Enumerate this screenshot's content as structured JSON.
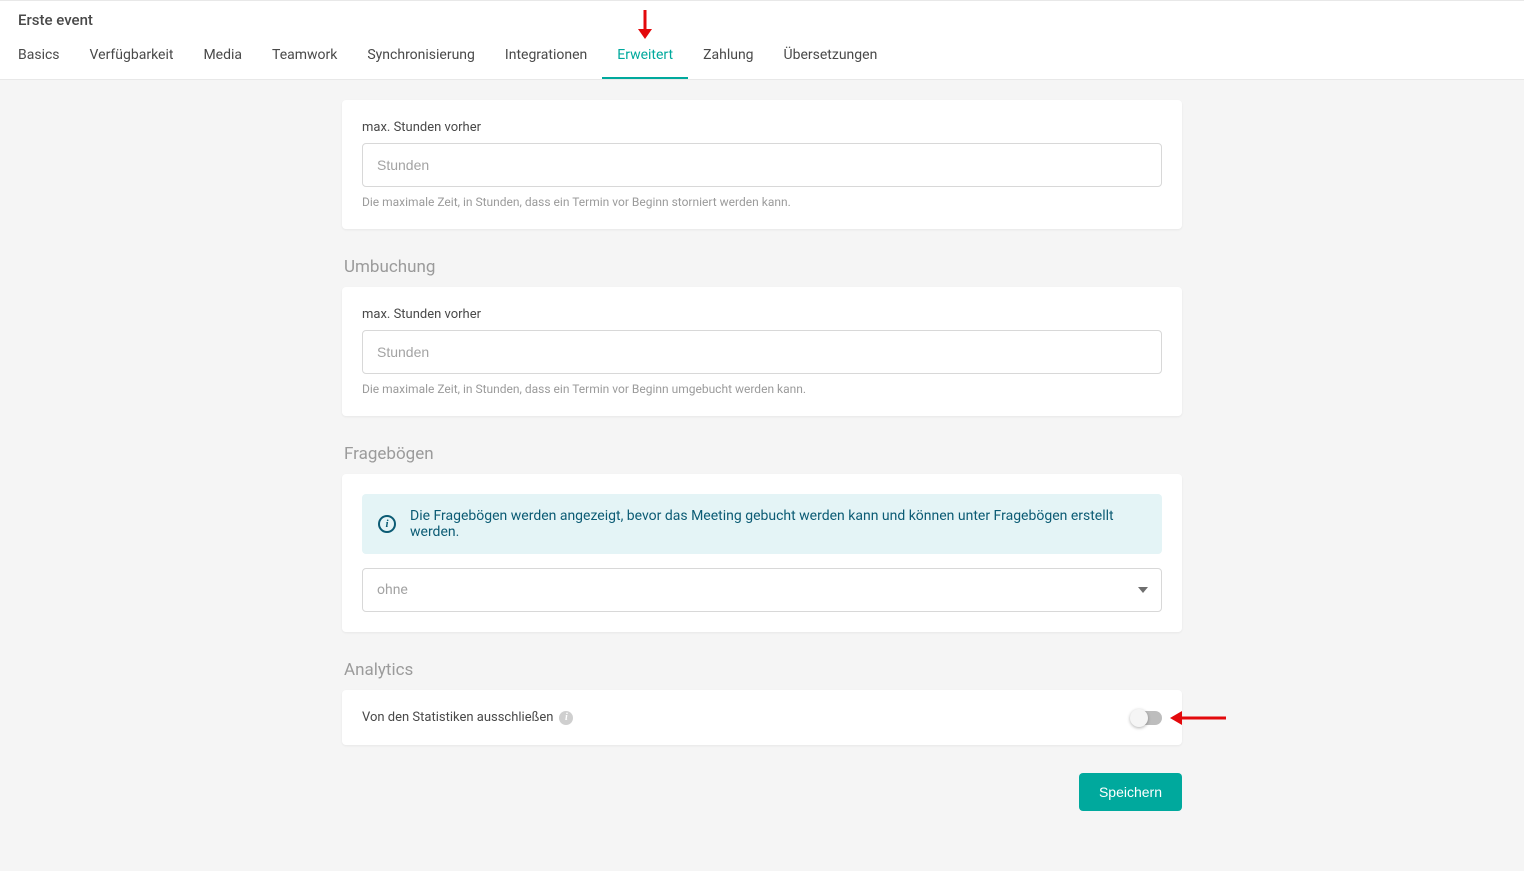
{
  "header": {
    "title": "Erste event",
    "tabs": [
      {
        "label": "Basics",
        "active": false
      },
      {
        "label": "Verfügbarkeit",
        "active": false
      },
      {
        "label": "Media",
        "active": false
      },
      {
        "label": "Teamwork",
        "active": false
      },
      {
        "label": "Synchronisierung",
        "active": false
      },
      {
        "label": "Integrationen",
        "active": false
      },
      {
        "label": "Erweitert",
        "active": true
      },
      {
        "label": "Zahlung",
        "active": false
      },
      {
        "label": "Übersetzungen",
        "active": false
      }
    ]
  },
  "sections": {
    "cancel": {
      "field_label": "max. Stunden vorher",
      "placeholder": "Stunden",
      "value": "",
      "help": "Die maximale Zeit, in Stunden, dass ein Termin vor Beginn storniert werden kann."
    },
    "rebook": {
      "title": "Umbuchung",
      "field_label": "max. Stunden vorher",
      "placeholder": "Stunden",
      "value": "",
      "help": "Die maximale Zeit, in Stunden, dass ein Termin vor Beginn umgebucht werden kann."
    },
    "survey": {
      "title": "Fragebögen",
      "info": "Die Fragebögen werden angezeigt, bevor das Meeting gebucht werden kann und können unter Fragebögen erstellt werden.",
      "selected": "ohne"
    },
    "analytics": {
      "title": "Analytics",
      "toggle_label": "Von den Statistiken ausschließen",
      "toggle_on": false
    }
  },
  "actions": {
    "save_label": "Speichern"
  }
}
